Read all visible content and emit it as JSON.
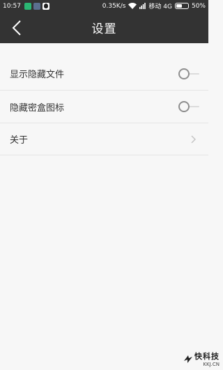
{
  "status_bar": {
    "time": "10:57",
    "speed": "0.35K/s",
    "carrier": "移动 4G",
    "battery": "50%",
    "battery_level": 0.5,
    "icons": [
      "green-app-icon",
      "blue-app-icon",
      "qq-icon",
      "wifi-icon",
      "signal-icon",
      "battery-icon"
    ]
  },
  "header": {
    "title": "设置",
    "back_icon": "chevron-left-icon"
  },
  "settings": {
    "items": [
      {
        "label": "显示隐藏文件",
        "control": "toggle",
        "state": "off"
      },
      {
        "label": "隐藏密盒图标",
        "control": "toggle",
        "state": "off"
      },
      {
        "label": "关于",
        "control": "chevron-right-icon"
      }
    ]
  },
  "watermark": {
    "main": "快科技",
    "sub": "KKJ.CN"
  },
  "colors": {
    "header_bg": "#333333",
    "page_bg": "#f7f7f7",
    "text": "#333333",
    "divider": "#e4e4e4",
    "toggle_off": "#8e8e8e"
  }
}
